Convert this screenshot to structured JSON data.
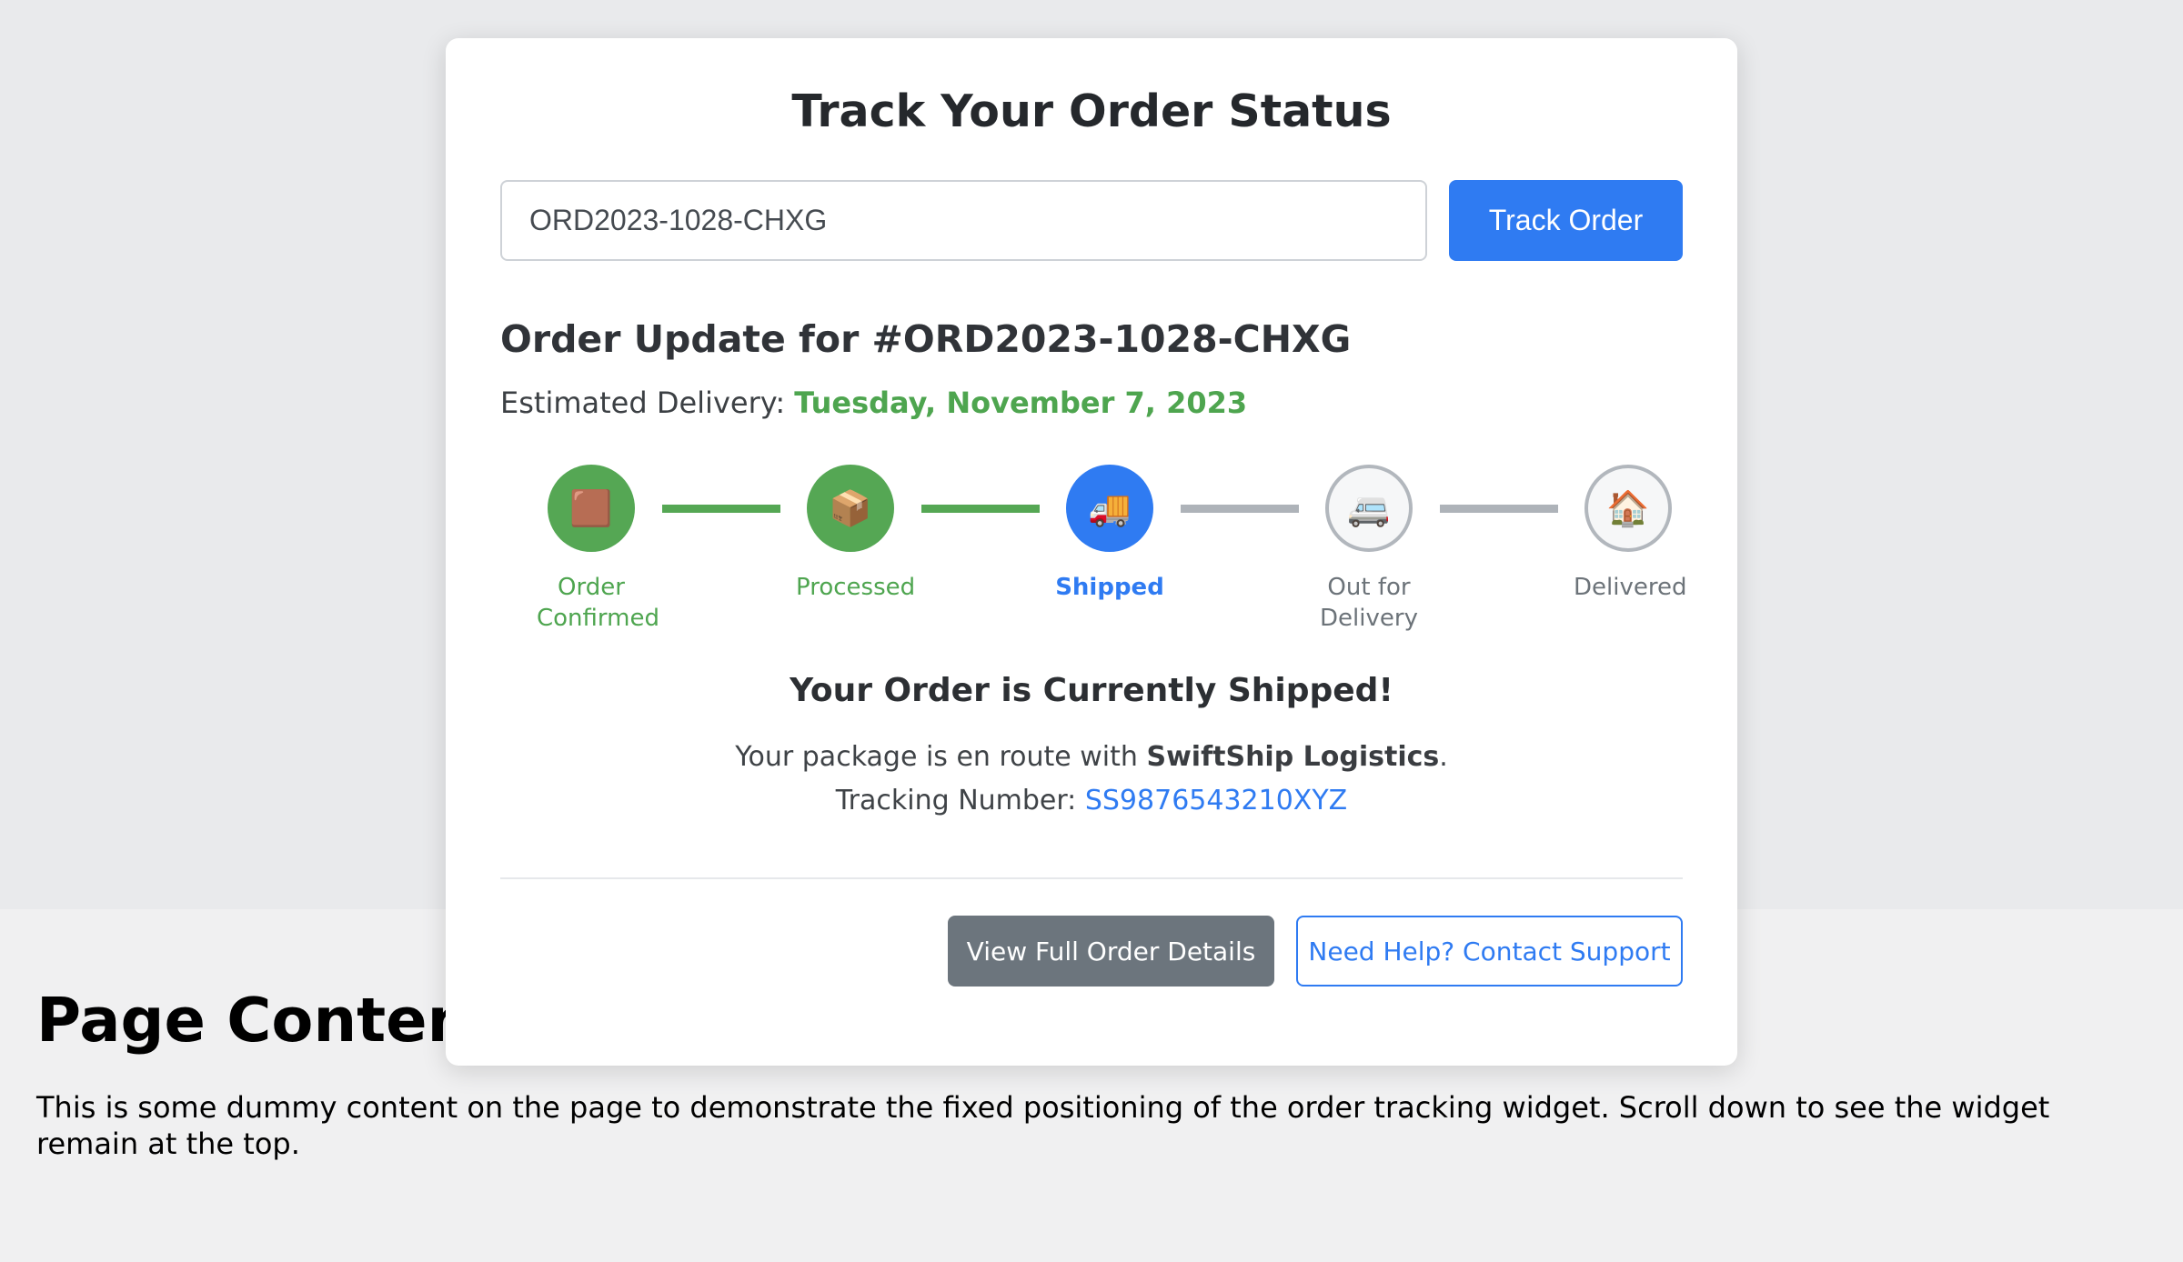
{
  "widget": {
    "title": "Track Your Order Status",
    "search": {
      "value": "ORD2023-1028-CHXG",
      "button_label": "Track Order"
    },
    "update_title": "Order Update for #ORD2023-1028-CHXG",
    "eta_label": "Estimated Delivery:",
    "eta_date": "Tuesday, November 7, 2023",
    "steps": [
      {
        "icon": "🟫",
        "icon_name": "box-closed-icon",
        "label": "Order Confirmed",
        "state": "done"
      },
      {
        "icon": "📦",
        "icon_name": "package-icon",
        "label": "Processed",
        "state": "done"
      },
      {
        "icon": "🚚",
        "icon_name": "delivery-truck-icon",
        "label": "Shipped",
        "state": "current"
      },
      {
        "icon": "🚐",
        "icon_name": "van-icon",
        "label": "Out for Delivery",
        "state": "pending"
      },
      {
        "icon": "🏠",
        "icon_name": "house-icon",
        "label": "Delivered",
        "state": "pending"
      }
    ],
    "status_title": "Your Order is Currently Shipped!",
    "status_text_prefix": "Your package is en route with",
    "carrier": "SwiftShip Logistics",
    "status_text_suffix": ".",
    "tracking_label": "Tracking Number:",
    "tracking_number": "SS9876543210XYZ",
    "details_button": "View Full Order Details",
    "support_button": "Need Help? Contact Support"
  },
  "page": {
    "heading": "Page Content",
    "body": "This is some dummy content on the page to demonstrate the fixed positioning of the order tracking widget. Scroll down to see the widget remain at the top."
  },
  "colors": {
    "primary": "#2f7bf2",
    "success": "#4ea54f",
    "pending": "#aeb3b9",
    "secondary": "#6c757d"
  }
}
